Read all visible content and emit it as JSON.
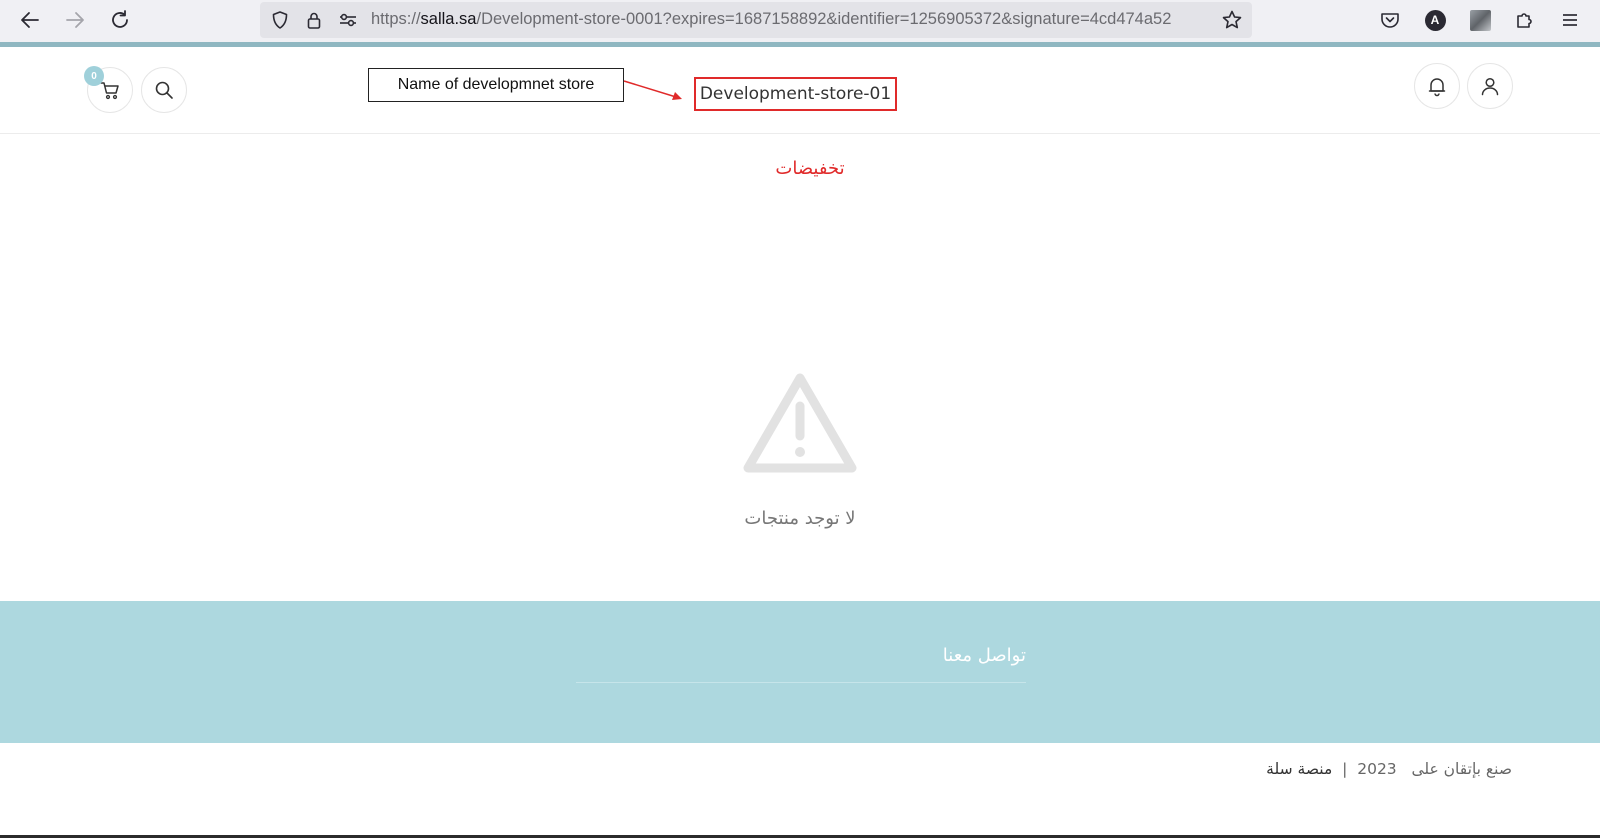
{
  "browser": {
    "url_host": "salla.sa",
    "url_rest": "/Development-store-0001?expires=1687158892&identifier=1256905372&signature=4cd474a52",
    "url_scheme": "https://",
    "profile_letter": "A"
  },
  "header": {
    "cart_count": "0",
    "store_name": "Development-store-01"
  },
  "annotation": {
    "label": "Name of developmnet store",
    "color": "#e02a2a"
  },
  "main": {
    "section_title": "تخفيضات",
    "empty_message": "لا توجد منتجات"
  },
  "footer": {
    "contact_title": "تواصل معنا",
    "made_with": "صنع بإتقان على",
    "year": "2023",
    "separator": "|",
    "platform": "منصة سلة"
  },
  "colors": {
    "accent": "#add8df",
    "badge": "#9fd0da",
    "red": "#e02a2a"
  },
  "icons": [
    "back-icon",
    "forward-icon",
    "reload-icon",
    "shield-icon",
    "lock-icon",
    "permissions-icon",
    "star-icon",
    "pocket-icon",
    "account-icon",
    "extension-avatar-icon",
    "extensions-icon",
    "menu-icon",
    "cart-icon",
    "search-icon",
    "bell-icon",
    "user-icon",
    "warning-icon"
  ]
}
